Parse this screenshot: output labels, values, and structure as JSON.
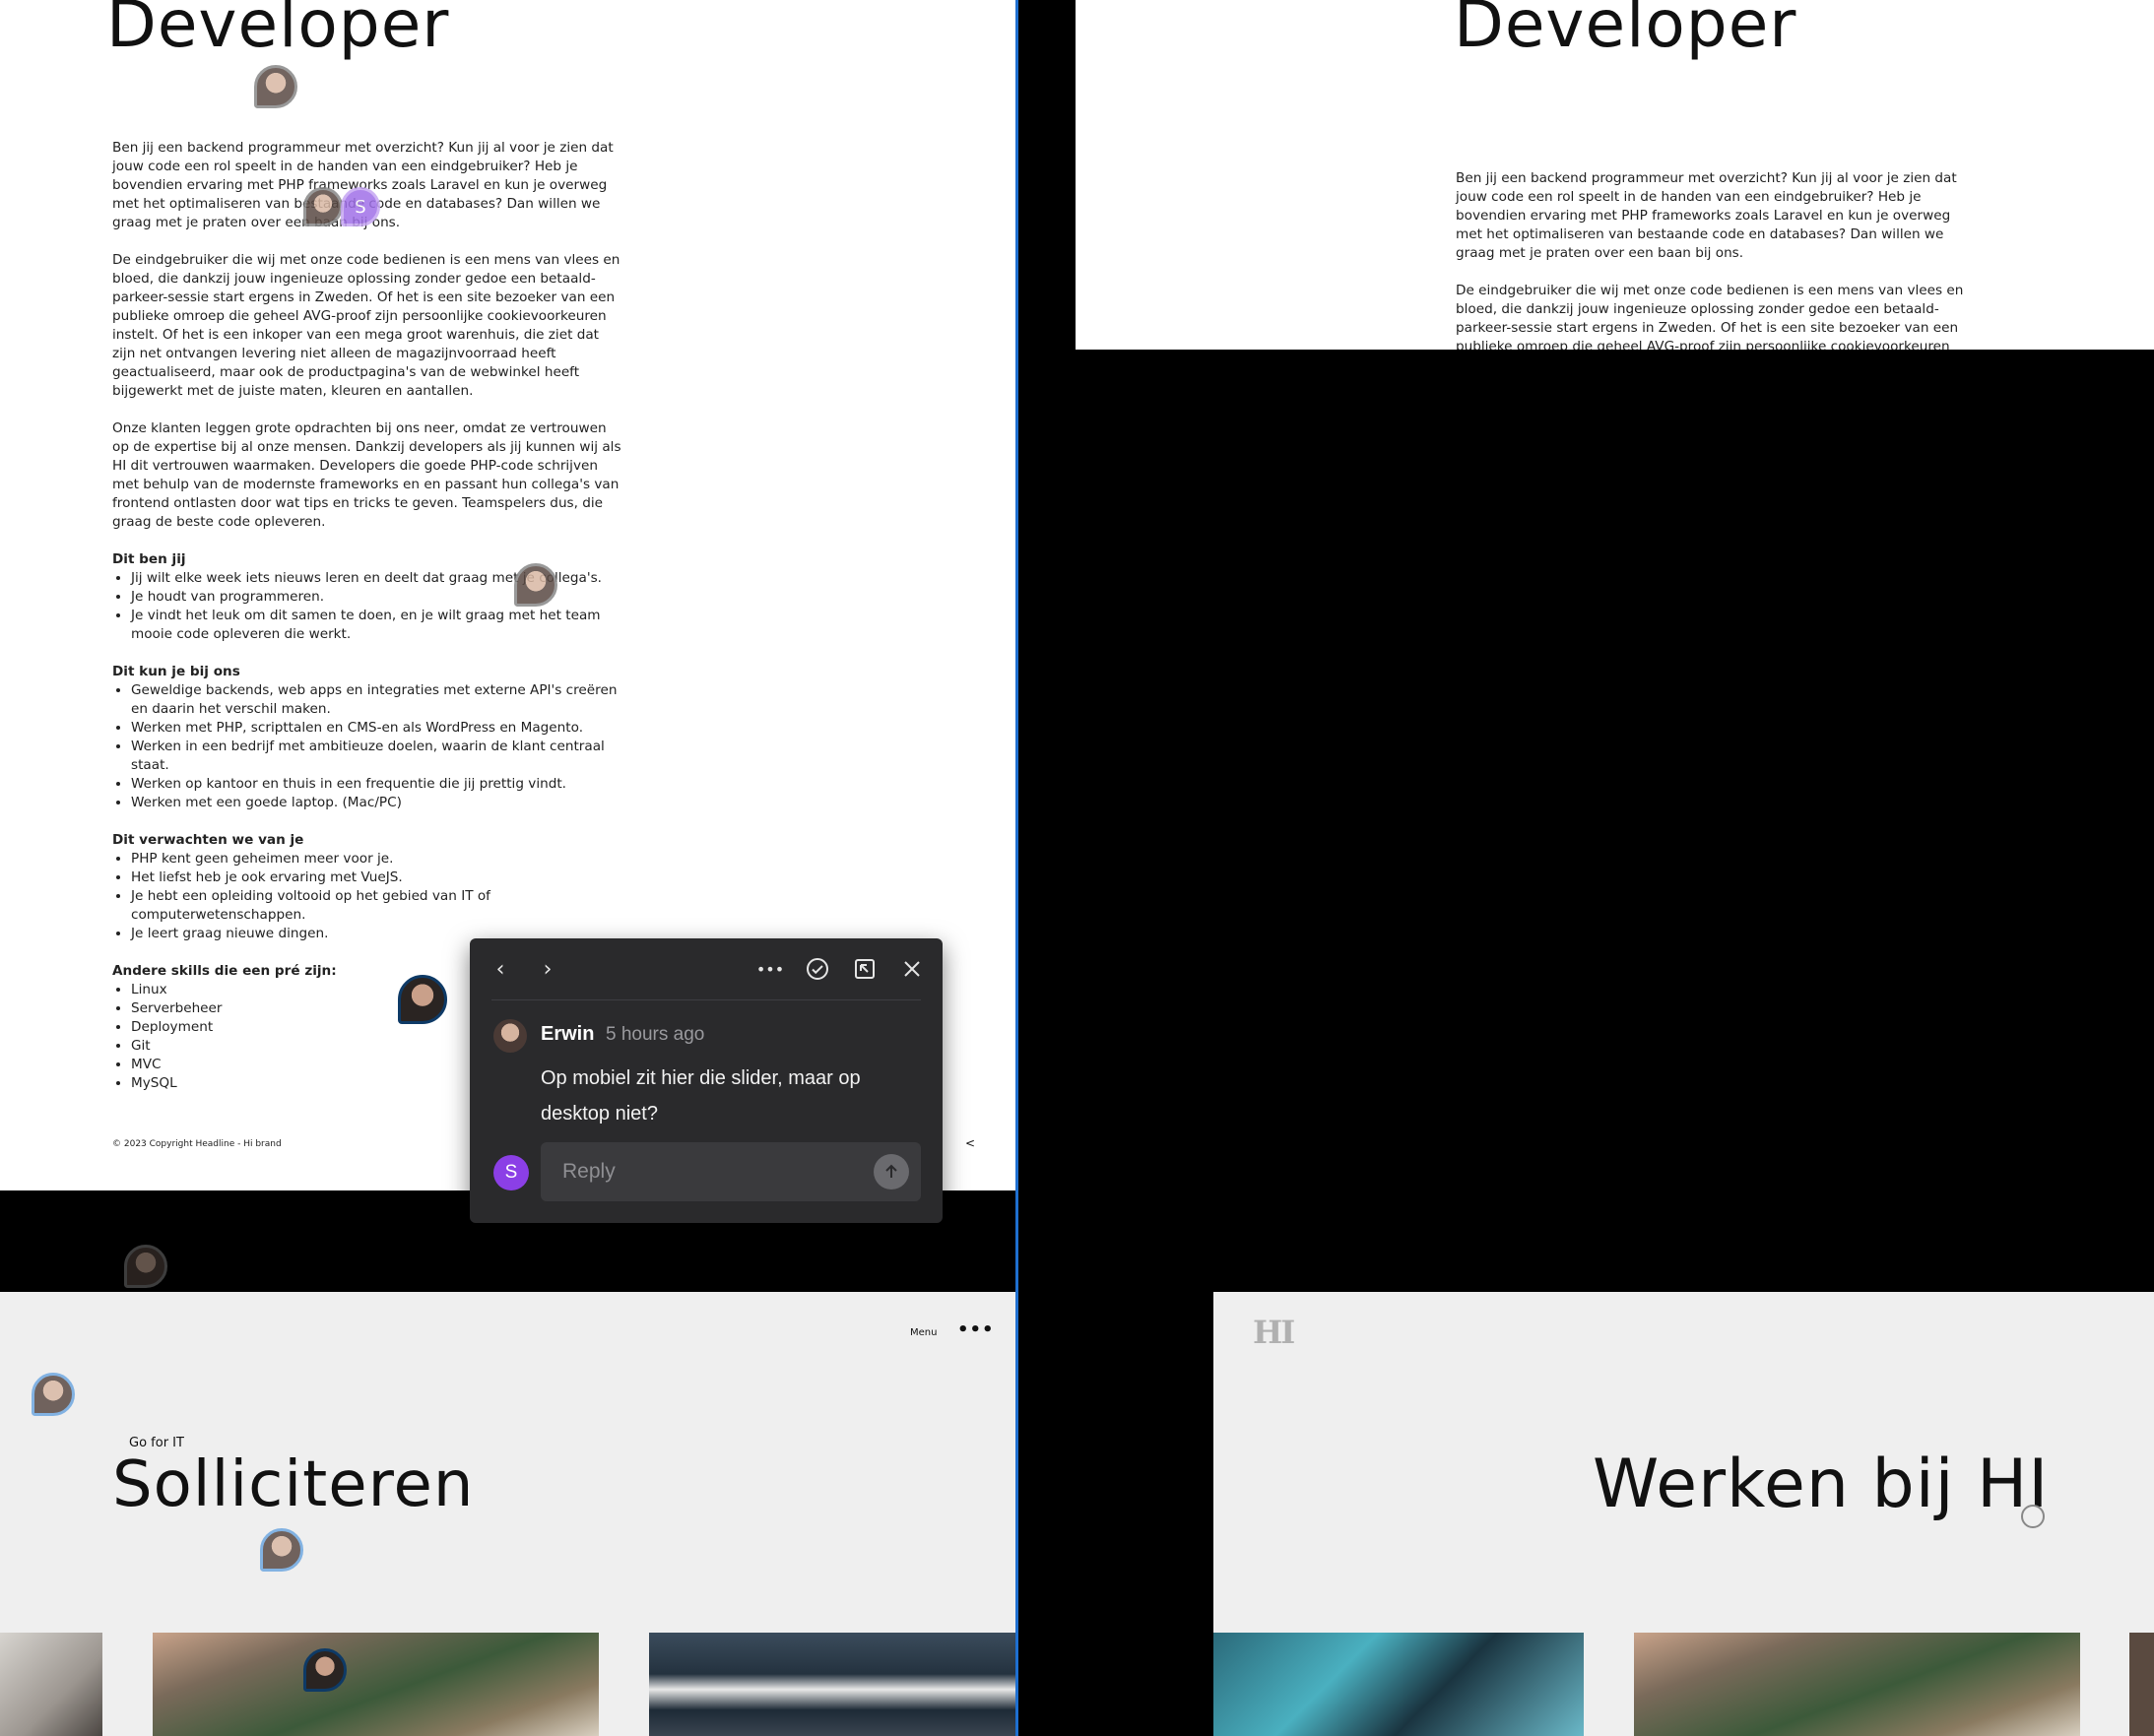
{
  "left_top": {
    "title": "Developer",
    "paragraphs": [
      "Ben jij een backend programmeur met overzicht? Kun jij al voor je zien dat jouw code een rol speelt in de handen van een eindgebruiker? Heb je bovendien ervaring met PHP frameworks zoals Laravel en kun je overweg met het optimaliseren van bestaande code en databases? Dan willen we graag met je praten over een baan bij ons.",
      "De eindgebruiker die wij met onze code bedienen is een mens van vlees en bloed, die dankzij jouw ingenieuze oplossing zonder gedoe een betaald-parkeer-sessie start ergens in Zweden. Of het is een site bezoeker van een publieke omroep die geheel AVG-proof zijn persoonlijke cookievoorkeuren instelt. Of het is een inkoper van een mega groot warenhuis, die ziet dat zijn net ontvangen levering niet alleen de magazijnvoorraad heeft geactualiseerd, maar ook de productpagina's van de webwinkel heeft bijgewerkt met de juiste maten, kleuren en aantallen.",
      "Onze klanten leggen grote opdrachten bij ons neer, omdat ze vertrouwen op de expertise bij al onze mensen. Dankzij developers als jij kunnen wij als HI dit vertrouwen waarmaken. Developers die goede PHP-code schrijven met behulp van de modernste frameworks en en passant hun collega's van frontend ontlasten door wat tips en tricks te geven. Teamspelers dus, die graag de beste code opleveren."
    ],
    "sections": [
      {
        "heading": "Dit ben jij",
        "items": [
          "Jij wilt elke week iets nieuws leren en deelt dat graag met je collega's.",
          "Je houdt van programmeren.",
          "Je vindt het leuk om dit samen te doen, en je wilt graag met het team mooie code opleveren die werkt."
        ]
      },
      {
        "heading": "Dit kun je bij ons",
        "items": [
          "Geweldige backends, web apps en integraties met externe API's creëren en daarin het verschil maken.",
          "Werken met PHP, scripttalen en CMS-en als WordPress en Magento.",
          "Werken in een bedrijf met ambitieuze doelen, waarin de klant centraal staat.",
          "Werken op kantoor en thuis in een frequentie die jij prettig vindt.",
          "Werken met een goede laptop. (Mac/PC)"
        ]
      },
      {
        "heading": "Dit verwachten we van je",
        "items": [
          "PHP kent geen geheimen meer voor je.",
          "Het liefst heb je ook ervaring met VueJS.",
          "Je hebt een opleiding voltooid op het gebied van IT of computerwetenschappen.",
          "Je leert graag nieuwe dingen."
        ]
      },
      {
        "heading": "Andere skills die een pré zijn:",
        "items": [
          "Linux",
          "Serverbeheer",
          "Deployment",
          "Git",
          "MVC",
          "MySQL"
        ]
      }
    ],
    "footer": "© 2023 Copyright Headline - Hi brand"
  },
  "right_top": {
    "title": "Developer",
    "paragraphs": [
      "Ben jij een backend programmeur met overzicht? Kun jij al voor je zien dat jouw code een rol speelt in de handen van een eindgebruiker? Heb je bovendien ervaring met PHP frameworks zoals Laravel en kun je overweg met het optimaliseren van bestaande code en databases? Dan willen we graag met je praten over een baan bij ons.",
      "De eindgebruiker die wij met onze code bedienen is een mens van vlees en bloed, die dankzij jouw ingenieuze oplossing zonder gedoe een betaald-parkeer-sessie start ergens in Zweden. Of het is een site bezoeker van een publieke omroep die geheel AVG-proof zijn persoonlijke cookievoorkeuren"
    ]
  },
  "left_bottom": {
    "menu_label": "Menu",
    "eyebrow": "Go for IT",
    "title": "Solliciteren"
  },
  "right_bottom": {
    "logo": "HI",
    "title": "Werken bij HI"
  },
  "comment": {
    "author": "Erwin",
    "time": "5 hours ago",
    "text": "Op mobiel zit hier die slider, maar op desktop niet?",
    "reply_placeholder": "Reply",
    "reply_avatar_initial": "S",
    "avatar_initial_badge": "S"
  },
  "icons": {
    "prev": "chevron-left-icon",
    "next": "chevron-right-icon",
    "more": "more-horizontal-icon",
    "resolve": "check-circle-icon",
    "open": "open-external-icon",
    "close": "close-icon",
    "send": "arrow-up-icon",
    "share": "share-icon"
  },
  "colors": {
    "accent_blue": "#1e6fd0",
    "popup_bg": "#2a2a2c",
    "reply_avatar": "#8b3fe6"
  }
}
